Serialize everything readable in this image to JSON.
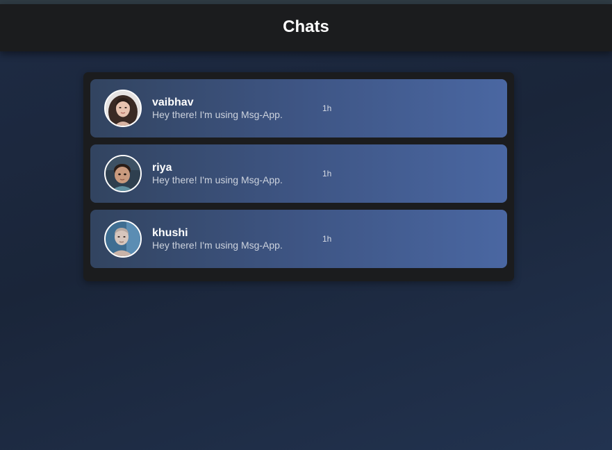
{
  "header": {
    "title": "Chats"
  },
  "chats": [
    {
      "name": "vaibhav",
      "message": "Hey there! I'm using Msg-App.",
      "time": "1h",
      "avatar_icon": "woman-portrait-avatar"
    },
    {
      "name": "riya",
      "message": "Hey there! I'm using Msg-App.",
      "time": "1h",
      "avatar_icon": "child-portrait-avatar"
    },
    {
      "name": "khushi",
      "message": "Hey there! I'm using Msg-App.",
      "time": "1h",
      "avatar_icon": "man-portrait-avatar"
    }
  ],
  "colors": {
    "header_bg": "#1b1c1e",
    "panel_bg": "#1b1c1e",
    "row_gradient_start": "#324460",
    "row_gradient_end": "#4a67a2",
    "page_bg": "#1e2b44"
  }
}
